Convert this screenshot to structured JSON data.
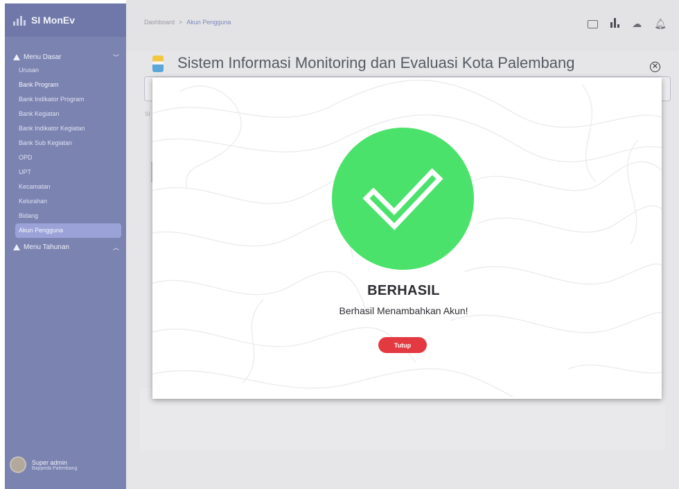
{
  "sidebar": {
    "brand": "SI MonEv",
    "section_basic": "Menu Dasar",
    "items": [
      {
        "label": "Urusan"
      },
      {
        "label": "Bank Program"
      },
      {
        "label": "Bank Indikator Program"
      },
      {
        "label": "Bank Kegiatan"
      },
      {
        "label": "Bank Indikator Kegiatan"
      },
      {
        "label": "Bank Sub Kegiatan"
      },
      {
        "label": "OPD"
      },
      {
        "label": "UPT"
      },
      {
        "label": "Kecamatan"
      },
      {
        "label": "Kelurahan"
      },
      {
        "label": "Bidang"
      },
      {
        "label": "Akun Pengguna"
      }
    ],
    "section_yearly": "Menu Tahunan",
    "user_name": "Super admin",
    "user_org": "Bappeda Palembang"
  },
  "breadcrumb": {
    "root": "Dashboard",
    "separator": ">",
    "current": "Akun Pengguna"
  },
  "header": {
    "title": "Sistem Informasi Monitoring dan Evaluasi Kota Palembang"
  },
  "underlay": {
    "fragment": "SI"
  },
  "modal": {
    "title": "BERHASIL",
    "message": "Berhasil Menambahkan Akun!",
    "button_label": "Tutup",
    "close_glyph": "✕"
  },
  "colors": {
    "sidebar": "#7b83b1",
    "success": "#4be26b",
    "danger": "#e33a42",
    "active_item": "#9aa2d8"
  },
  "icons": [
    "chat-icon",
    "bar-chart-icon",
    "cloud-icon",
    "bell-icon",
    "close-icon",
    "checkmark-icon"
  ]
}
